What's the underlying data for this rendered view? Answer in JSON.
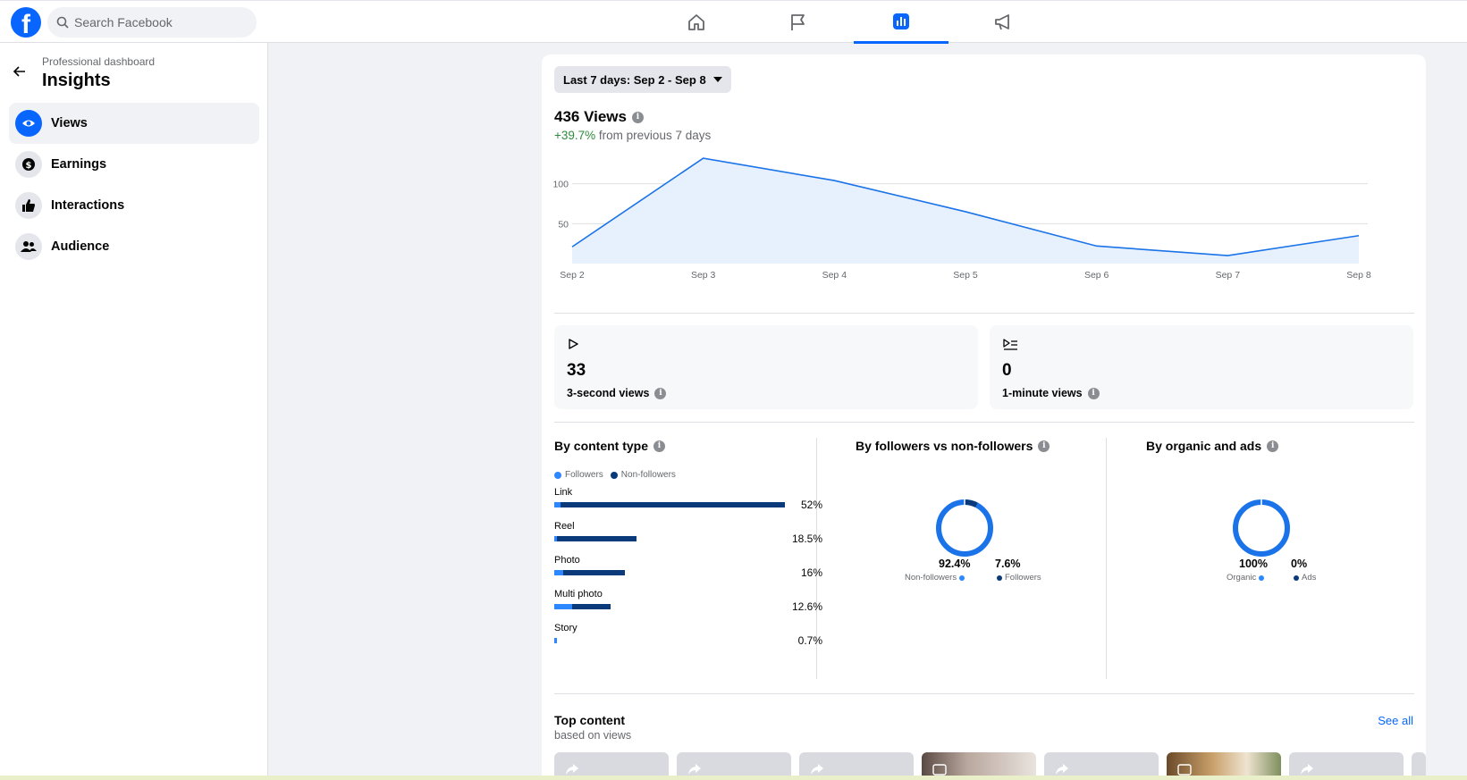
{
  "search": {
    "placeholder": "Search Facebook"
  },
  "nav": {
    "tabs": [
      {
        "icon": "home-icon"
      },
      {
        "icon": "flag-icon"
      },
      {
        "icon": "insights-icon",
        "active": true
      },
      {
        "icon": "megaphone-icon"
      }
    ]
  },
  "sidebar": {
    "breadcrumb": "Professional dashboard",
    "title": "Insights",
    "items": [
      {
        "label": "Views",
        "icon": "eye-icon",
        "active": true
      },
      {
        "label": "Earnings",
        "icon": "dollar-icon"
      },
      {
        "label": "Interactions",
        "icon": "thumbs-up-icon"
      },
      {
        "label": "Audience",
        "icon": "people-icon"
      }
    ]
  },
  "main": {
    "date_range": "Last 7 days: Sep 2 - Sep 8",
    "views_total": "436 Views",
    "change_pct": "+39.7%",
    "change_text": " from previous 7 days",
    "stats": [
      {
        "value": "33",
        "label": "3-second views"
      },
      {
        "value": "0",
        "label": "1-minute views"
      }
    ],
    "content_type": {
      "title": "By content type",
      "legend": [
        "Followers",
        "Non-followers"
      ],
      "rows": [
        {
          "name": "Link",
          "pct": "52%",
          "followers": 1.5,
          "non_followers": 50.5
        },
        {
          "name": "Reel",
          "pct": "18.5%",
          "followers": 0.5,
          "non_followers": 18
        },
        {
          "name": "Photo",
          "pct": "16%",
          "followers": 2,
          "non_followers": 14
        },
        {
          "name": "Multi photo",
          "pct": "12.6%",
          "followers": 4,
          "non_followers": 8.6
        },
        {
          "name": "Story",
          "pct": "0.7%",
          "followers": 0.7,
          "non_followers": 0
        }
      ]
    },
    "followers_split": {
      "title": "By followers vs non-followers",
      "left_value": "92.4%",
      "left_label": "Non-followers",
      "right_value": "7.6%",
      "right_label": "Followers"
    },
    "organic_split": {
      "title": "By organic and ads",
      "left_value": "100%",
      "left_label": "Organic",
      "right_value": "0%",
      "right_label": "Ads"
    },
    "top_content": {
      "title": "Top content",
      "subtitle": "based on views",
      "see_all": "See all"
    }
  },
  "colors": {
    "accent": "#0866ff",
    "followers": "#2d88ff",
    "non_followers": "#0a3a7a",
    "positive": "#2e8b3d"
  },
  "chart_data": {
    "type": "area",
    "x": [
      "Sep 2",
      "Sep 3",
      "Sep 4",
      "Sep 5",
      "Sep 6",
      "Sep 7",
      "Sep 8"
    ],
    "values": [
      21,
      132,
      104,
      65,
      22,
      10,
      35
    ],
    "yticks": [
      50,
      100
    ],
    "ylim": [
      0,
      150
    ],
    "grid": true
  }
}
